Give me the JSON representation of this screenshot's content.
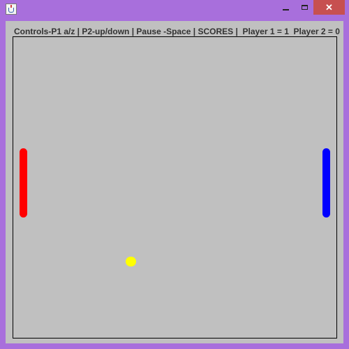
{
  "window": {
    "frame_color": "#a86fdc",
    "icon": "java-cup-icon",
    "controls": {
      "minimize_glyph": "",
      "maximize_glyph": "",
      "close_glyph": "✕"
    }
  },
  "game": {
    "status_line": "Controls-P1 a/z | P2-up/down | Pause -Space | SCORES |  Player 1 = 1  Player 2 = 0",
    "background_color": "#c0c0c0",
    "player1": {
      "color": "#ff0000",
      "score": 1
    },
    "player2": {
      "color": "#0000ff",
      "score": 0
    },
    "ball": {
      "color": "#ffff00"
    }
  }
}
